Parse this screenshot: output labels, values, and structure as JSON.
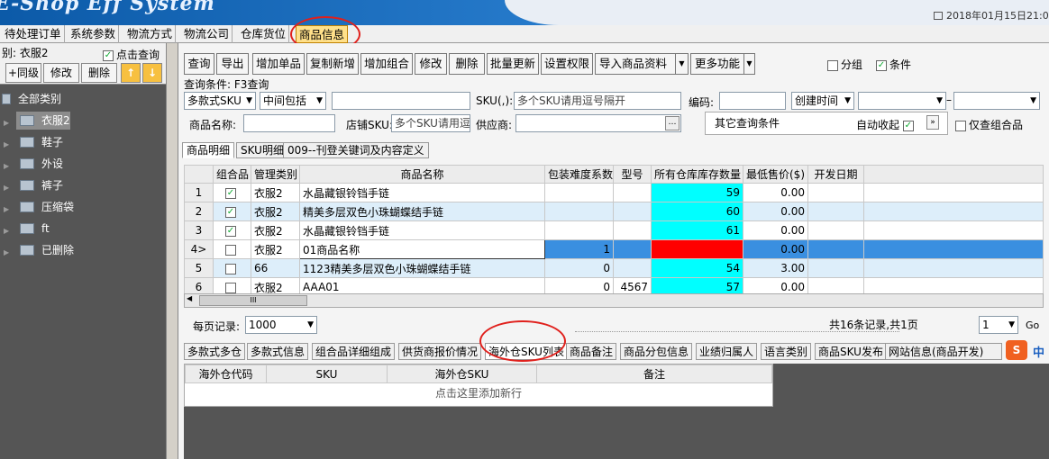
{
  "banner": {
    "title": "E-Shop Eff System",
    "date": "2018年01月15日21:0"
  },
  "menu": [
    {
      "label": "待处理订单"
    },
    {
      "label": "系统参数"
    },
    {
      "label": "物流方式"
    },
    {
      "label": "物流公司"
    },
    {
      "label": "仓库货位"
    },
    {
      "label": "商品信息",
      "active": true
    }
  ],
  "left": {
    "category_label": "别: 衣服2",
    "click_query": "点击查询",
    "buttons": {
      "add_level": "+同级",
      "edit": "修改",
      "delete": "删除"
    },
    "tree": {
      "root": "全部类别",
      "items": [
        "衣服2",
        "鞋子",
        "外设",
        "裤子",
        "压缩袋",
        "ft",
        "已删除"
      ]
    }
  },
  "toolbar": {
    "buttons": [
      "查询",
      "导出",
      "增加单品",
      "复制新增",
      "增加组合",
      "修改",
      "删除",
      "批量更新",
      "设置权限",
      "导入商品资料",
      "更多功能"
    ],
    "group_label": "分组",
    "condition_label": "条件"
  },
  "filters": {
    "query_condition": "查询条件: F3查询",
    "sel1": "多款式SKU",
    "sel2": "中间包括",
    "sku_label": "SKU(,):",
    "sku_placeholder": "多个SKU请用逗号隔开",
    "code_label": "编码:",
    "date_sel": "创建时间",
    "name_label": "商品名称:",
    "store_sku_label": "店铺SKU:",
    "store_sku_placeholder": "多个SKU请用逗号隔开",
    "supplier_label": "供应商:",
    "other_conditions": "其它查询条件",
    "auto_collapse": "自动收起",
    "only_combo": "仅查组合品"
  },
  "tabs": [
    "商品明细",
    "SKU明细",
    "009--刊登关键词及内容定义"
  ],
  "table": {
    "headers": [
      "",
      "组合品",
      "管理类别",
      "商品名称",
      "包装难度系数",
      "型号",
      "所有仓库库存数量",
      "最低售价($)",
      "开发日期"
    ],
    "rows": [
      {
        "idx": "1",
        "checked": true,
        "cat": "衣服2",
        "name": "水晶藏银铃铛手链",
        "pack": "",
        "model": "",
        "stock": "59",
        "price": "0.00",
        "date": ""
      },
      {
        "idx": "2",
        "checked": true,
        "cat": "衣服2",
        "name": "精美多层双色小珠蝴蝶结手链",
        "pack": "",
        "model": "",
        "stock": "60",
        "price": "0.00",
        "date": ""
      },
      {
        "idx": "3",
        "checked": true,
        "cat": "衣服2",
        "name": "水晶藏银铃铛手链",
        "pack": "",
        "model": "",
        "stock": "61",
        "price": "0.00",
        "date": ""
      },
      {
        "idx": "4>",
        "checked": false,
        "cat": "衣服2",
        "name": "01商品名称",
        "pack": "1",
        "model": "",
        "stock": "",
        "price": "0.00",
        "date": ""
      },
      {
        "idx": "5",
        "checked": false,
        "cat": "66",
        "name": "1123精美多层双色小珠蝴蝶结手链",
        "pack": "0",
        "model": "",
        "stock": "54",
        "price": "3.00",
        "date": ""
      },
      {
        "idx": "6",
        "checked": false,
        "cat": "衣服2",
        "name": "AAA01",
        "pack": "0",
        "model": "4567",
        "stock": "57",
        "price": "0.00",
        "date": ""
      }
    ],
    "scroll_grip": "III"
  },
  "pager": {
    "per_page_label": "每页记录:",
    "per_page": "1000",
    "summary": "共16条记录,共1页",
    "page": "1",
    "go": "Go"
  },
  "bottom_tabs": [
    "多款式多仓",
    "多款式信息",
    "组合品详细组成",
    "供货商报价情况",
    "海外仓SKU列表",
    "商品备注",
    "商品分包信息",
    "业绩归属人",
    "语言类别",
    "商品SKU发布",
    "网站信息(商品开发)"
  ],
  "subgrid": {
    "headers": [
      "海外仓代码",
      "SKU",
      "海外仓SKU",
      "备注"
    ],
    "add_row": "点击这里添加新行"
  },
  "ime_logo": "S",
  "ime_text": "中"
}
